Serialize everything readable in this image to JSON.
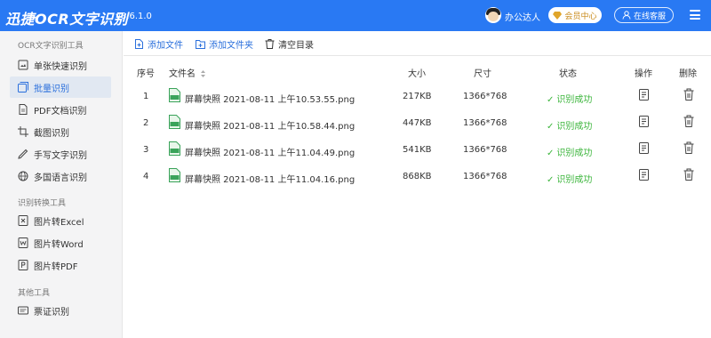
{
  "app": {
    "title": "迅捷OCR文字识别",
    "version": "v8.6.1.0"
  },
  "header": {
    "user_name": "办公达人",
    "vip_label": "会员中心",
    "service_label": "在线客服"
  },
  "sidebar": {
    "sections": [
      {
        "title": "OCR文字识别工具",
        "items": [
          {
            "label": "单张快速识别",
            "icon": "image-scan-icon"
          },
          {
            "label": "批量识别",
            "icon": "batch-images-icon",
            "active": true
          },
          {
            "label": "PDF文档识别",
            "icon": "pdf-icon"
          },
          {
            "label": "截图识别",
            "icon": "crop-icon"
          },
          {
            "label": "手写文字识别",
            "icon": "handwriting-icon"
          },
          {
            "label": "多国语言识别",
            "icon": "globe-icon"
          }
        ]
      },
      {
        "title": "识别转换工具",
        "items": [
          {
            "label": "图片转Excel",
            "icon": "excel-icon"
          },
          {
            "label": "图片转Word",
            "icon": "word-icon"
          },
          {
            "label": "图片转PDF",
            "icon": "pdf-file-icon"
          }
        ]
      },
      {
        "title": "其他工具",
        "items": [
          {
            "label": "票证识别",
            "icon": "ticket-icon"
          }
        ]
      }
    ]
  },
  "toolbar": {
    "add_file": "添加文件",
    "add_folder": "添加文件夹",
    "clear": "清空目录"
  },
  "table": {
    "headers": {
      "index": "序号",
      "filename": "文件名",
      "size": "大小",
      "dimensions": "尺寸",
      "status": "状态",
      "action": "操作",
      "delete": "删除"
    },
    "rows": [
      {
        "index": "1",
        "filename": "屏幕快照 2021-08-11 上午10.53.55.png",
        "size": "217KB",
        "dimensions": "1366*768",
        "status": "识别成功"
      },
      {
        "index": "2",
        "filename": "屏幕快照 2021-08-11 上午10.58.44.png",
        "size": "447KB",
        "dimensions": "1366*768",
        "status": "识别成功"
      },
      {
        "index": "3",
        "filename": "屏幕快照 2021-08-11 上午11.04.49.png",
        "size": "541KB",
        "dimensions": "1366*768",
        "status": "识别成功"
      },
      {
        "index": "4",
        "filename": "屏幕快照 2021-08-11 上午11.04.16.png",
        "size": "868KB",
        "dimensions": "1366*768",
        "status": "识别成功"
      }
    ]
  },
  "colors": {
    "brand": "#2979f3",
    "success": "#3bb53b",
    "active_bg": "#e1e8f2",
    "link": "#2a6fdc"
  }
}
